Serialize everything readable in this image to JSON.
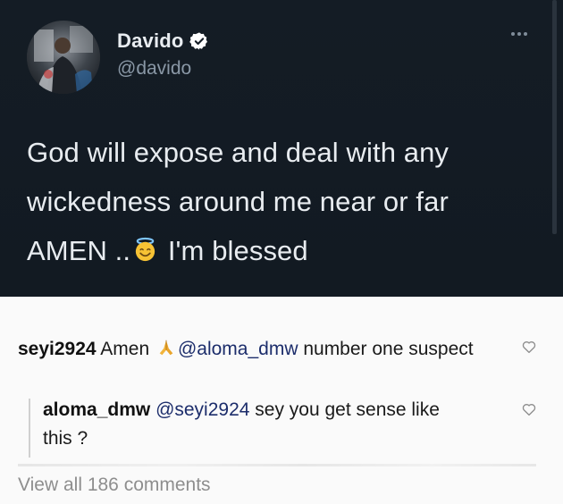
{
  "tweet": {
    "author_name": "Davido",
    "author_handle": "@davido",
    "line1": "God will expose and deal with any",
    "line2": "wickedness around me near or far",
    "line3_before": "AMEN ..",
    "line3_after": " I'm blessed",
    "emoji": "smiling-face-with-halo",
    "colors": {
      "background": "#141c25",
      "text": "#e8ecf0",
      "handle": "#8a98a6",
      "verified": "#ffffff"
    }
  },
  "comments": [
    {
      "username": "seyi2924",
      "text_before": " Amen ",
      "emoji": "folded-hands",
      "mention": "@aloma_dmw",
      "text_after": " number one suspect"
    },
    {
      "username": "aloma_dmw",
      "mention": "@seyi2924",
      "text_after": " sey you get sense like this ?"
    }
  ],
  "view_all_label": "View all 186 comments",
  "icons": {
    "like": "heart-outline-icon",
    "more": "more-horizontal-icon",
    "verified": "verified-badge-icon"
  }
}
